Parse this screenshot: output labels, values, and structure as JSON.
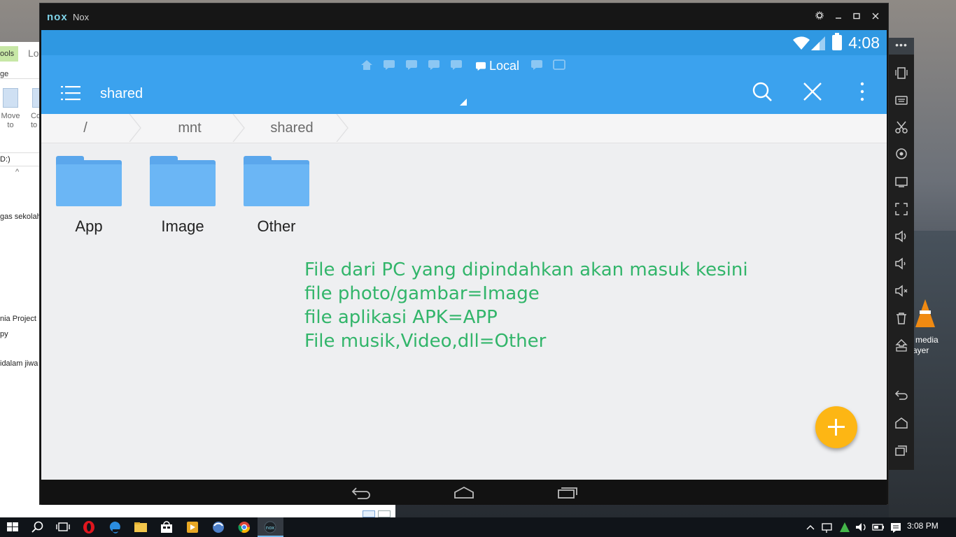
{
  "explorer": {
    "tab_tools": "ools",
    "tab_lo": "Lo",
    "tab_ge": "ge",
    "move_label_1": "Move",
    "move_label_2": "to",
    "co_label_1": "Co",
    "co_label_2": "to",
    "address": "D:)",
    "items": [
      "gas sekolah",
      "nia Project",
      "py",
      "idalam jiwa"
    ]
  },
  "desktop": {
    "vlc_label_1": "media",
    "vlc_label_2": "ayer"
  },
  "nox": {
    "logo": "nox",
    "title": "Nox",
    "clock": "4:08",
    "tab_local": "Local",
    "folder_title": "shared",
    "breadcrumb": [
      "/",
      "mnt",
      "shared"
    ],
    "folders": [
      "App",
      "Image",
      "Other"
    ],
    "note_lines": [
      "File dari PC yang dipindahkan akan masuk kesini",
      "file photo/gambar=Image",
      "file aplikasi APK=APP",
      "File musik,Video,dll=Other"
    ],
    "side_more": "•••"
  },
  "taskbar": {
    "time": "3:08 PM"
  },
  "colors": {
    "app_bar": "#3ba2ee",
    "status_bar": "#2f98e2",
    "folder": "#6bb6f5",
    "note_text": "#32b56a",
    "fab": "#fdb614"
  }
}
